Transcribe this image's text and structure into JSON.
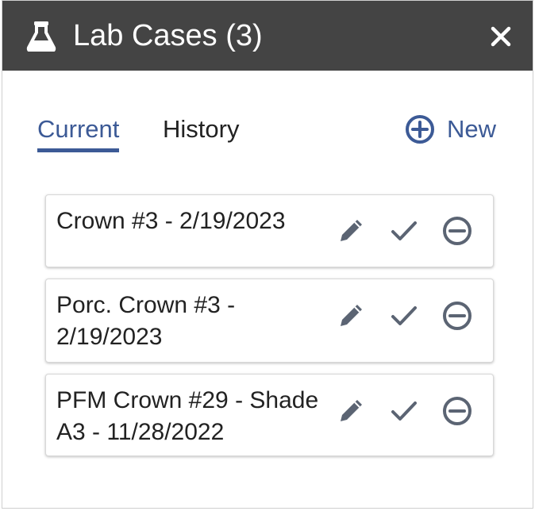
{
  "header": {
    "icon": "flask-icon",
    "title": "Lab Cases (3)",
    "close_icon": "close-icon"
  },
  "tabs": [
    {
      "label": "Current",
      "active": true
    },
    {
      "label": "History",
      "active": false
    }
  ],
  "new_button": {
    "icon": "plus-circle-icon",
    "label": "New"
  },
  "cases": [
    {
      "text": "Crown #3 - 2/19/2023"
    },
    {
      "text": "Porc. Crown #3 - 2/19/2023"
    },
    {
      "text": "PFM Crown #29 - Shade A3 - 11/28/2022"
    }
  ],
  "case_action_icons": [
    "pencil-icon",
    "check-icon",
    "minus-circle-icon"
  ],
  "colors": {
    "titlebar": "#444444",
    "accent": "#3c5a96",
    "icon_gray": "#5b6473",
    "text": "#222222"
  }
}
